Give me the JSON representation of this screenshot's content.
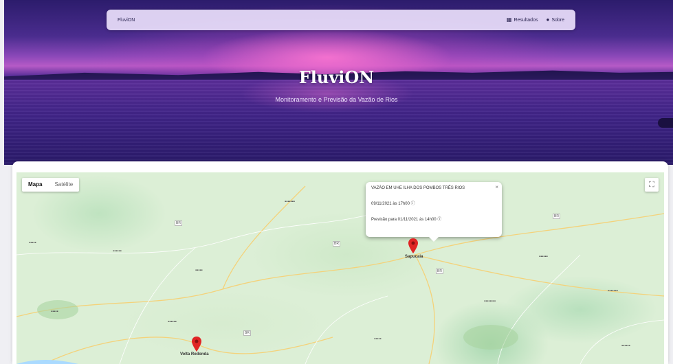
{
  "header": {
    "brand": "FluviON",
    "nav": [
      {
        "label": "Resultados",
        "icon": "chart-icon"
      },
      {
        "label": "Sobre",
        "icon": "info-icon"
      }
    ]
  },
  "hero": {
    "title": "FluviON",
    "subtitle": "Monitoramento e Previsão da Vazão de Rios"
  },
  "map": {
    "type_buttons": {
      "map": "Mapa",
      "satellite": "Satélite"
    },
    "fullscreen_icon": "fullscreen-icon",
    "info_window": {
      "line1": "VAZÃO EM UHE ILHA DOS POMBOS TRÊS RIOS",
      "line2": "09/11/2021 às 17h00  ⓘ",
      "line3": "Previsão para 01/11/2021 às 14h00  ⓘ"
    },
    "marker_color": "#e02424",
    "marker_labels": {
      "marker2": "Volta Redonda",
      "marker1": "Sapucaia"
    }
  }
}
